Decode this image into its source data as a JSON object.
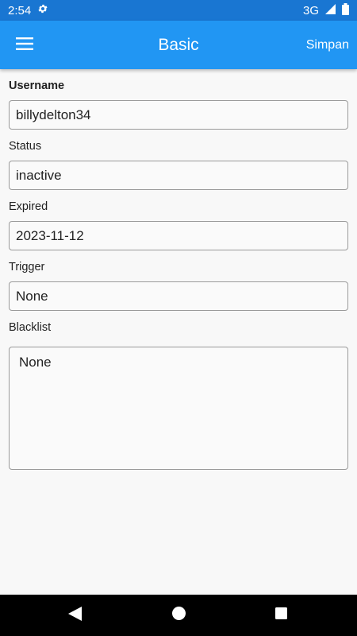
{
  "status_bar": {
    "time": "2:54",
    "network": "3G"
  },
  "app_bar": {
    "title": "Basic",
    "save_label": "Simpan",
    "color": "#2196f3"
  },
  "form": {
    "username": {
      "label": "Username",
      "value": "billydelton34"
    },
    "status": {
      "label": "Status",
      "value": "inactive"
    },
    "expired": {
      "label": "Expired",
      "value": "2023-11-12"
    },
    "trigger": {
      "label": "Trigger",
      "value": "None"
    },
    "blacklist": {
      "label": "Blacklist",
      "value": "None"
    }
  },
  "icons": {
    "menu": "menu-icon",
    "settings": "gear-icon",
    "signal": "signal-icon",
    "battery": "battery-icon",
    "back": "back-icon",
    "home": "home-icon",
    "recents": "recents-icon"
  }
}
